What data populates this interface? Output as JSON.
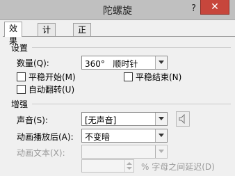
{
  "window": {
    "title": "陀螺旋",
    "help": "?",
    "close": "✕"
  },
  "tabs": [
    {
      "label": "效果"
    },
    {
      "label": "计时"
    },
    {
      "label": "正文文本动画"
    }
  ],
  "settings": {
    "heading": "设置",
    "amount_label": "数量(Q):",
    "amount_value": "360°   顺时针",
    "smooth_start": "平稳开始(M)",
    "smooth_end": "平稳结束(N)",
    "auto_reverse": "自动翻转(U)"
  },
  "enhancements": {
    "heading": "增强",
    "sound_label": "声音(S):",
    "sound_value": "[无声音]",
    "after_anim_label": "动画播放后(A):",
    "after_anim_value": "不变暗",
    "animate_text_label": "动画文本(X):",
    "animate_text_value": "",
    "delay_value": "",
    "delay_suffix": "% 字母之间延迟(D)"
  }
}
